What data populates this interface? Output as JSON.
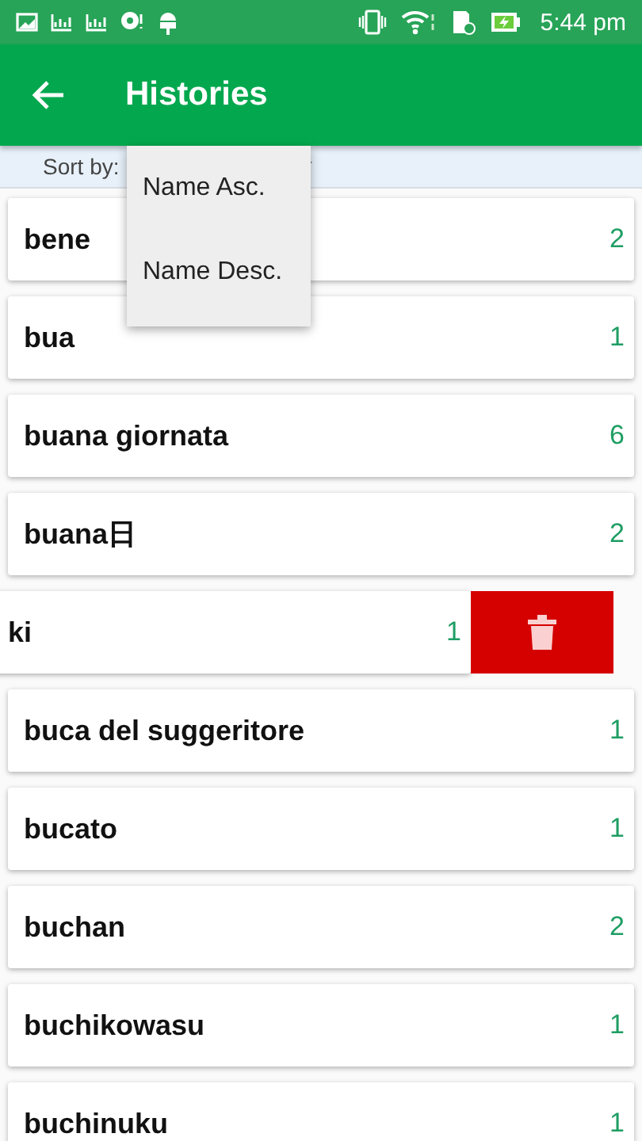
{
  "status_bar": {
    "time": "5:44 pm"
  },
  "app_bar": {
    "title": "Histories"
  },
  "sort": {
    "label": "Sort by:",
    "menu": [
      {
        "label": "Name Asc."
      },
      {
        "label": "Name Desc."
      }
    ]
  },
  "rows": [
    {
      "word": "bene",
      "count": "2",
      "swiped": false
    },
    {
      "word": "bua",
      "count": "1",
      "swiped": false
    },
    {
      "word": "buana giornata",
      "count": "6",
      "swiped": false
    },
    {
      "word": "buana日",
      "count": "2",
      "swiped": false
    },
    {
      "word": "ki",
      "count": "1",
      "swiped": true
    },
    {
      "word": "buca del suggeritore",
      "count": "1",
      "swiped": false
    },
    {
      "word": "bucato",
      "count": "1",
      "swiped": false
    },
    {
      "word": "buchan",
      "count": "2",
      "swiped": false
    },
    {
      "word": "buchikowasu",
      "count": "1",
      "swiped": false
    },
    {
      "word": "buchinuku",
      "count": "1",
      "swiped": false
    }
  ]
}
